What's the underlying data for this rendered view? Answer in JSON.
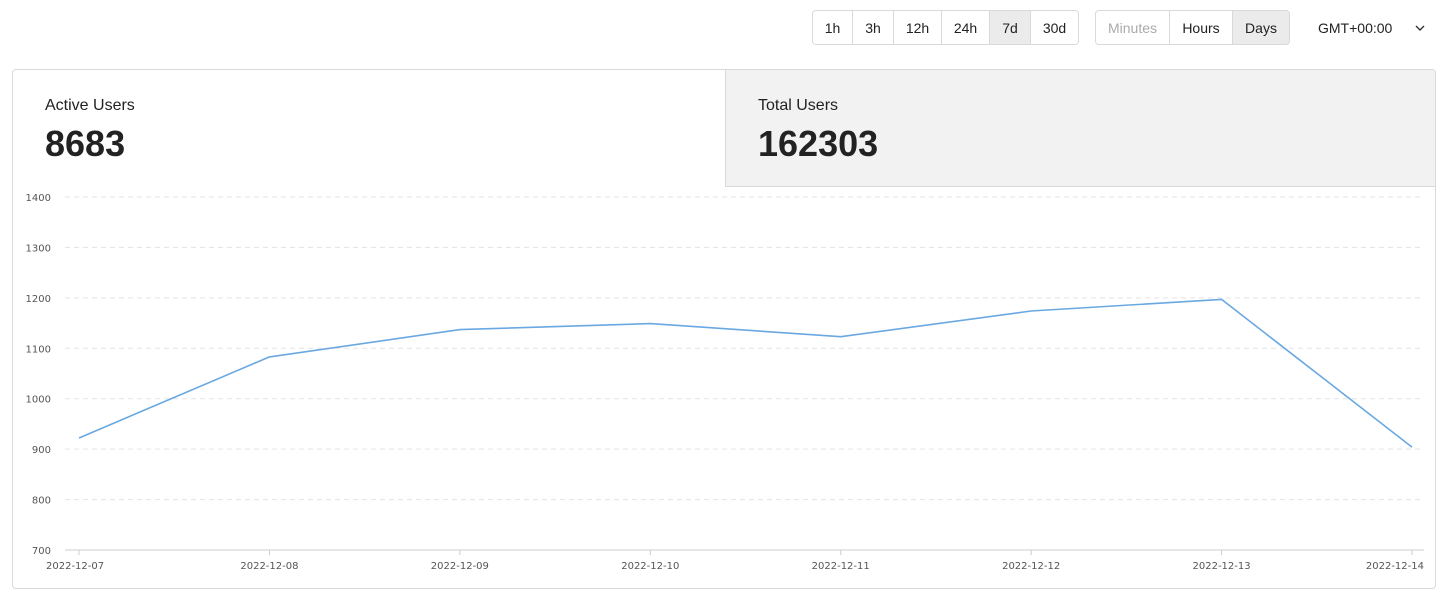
{
  "toolbar": {
    "ranges": [
      "1h",
      "3h",
      "12h",
      "24h",
      "7d",
      "30d"
    ],
    "active_range": "7d",
    "granularities": [
      "Minutes",
      "Hours",
      "Days"
    ],
    "active_granularity": "Days",
    "disabled_granularity": "Minutes",
    "timezone": "GMT+00:00"
  },
  "cards": {
    "active_users": {
      "label": "Active Users",
      "value": "8683"
    },
    "total_users": {
      "label": "Total Users",
      "value": "162303"
    }
  },
  "colors": {
    "line": "#6aa8e2",
    "grid": "#e3e3e3"
  },
  "chart_data": {
    "type": "line",
    "x": [
      "2022-12-07",
      "2022-12-08",
      "2022-12-09",
      "2022-12-10",
      "2022-12-11",
      "2022-12-12",
      "2022-12-13",
      "2022-12-14"
    ],
    "series": [
      {
        "values": [
          922,
          1083,
          1137,
          1149,
          1123,
          1174,
          1197,
          904
        ]
      }
    ],
    "yticks": [
      "700",
      "800",
      "900",
      "1000",
      "1100",
      "1200",
      "1300",
      "1400"
    ],
    "ylim": [
      700,
      1400
    ],
    "grid": true
  }
}
